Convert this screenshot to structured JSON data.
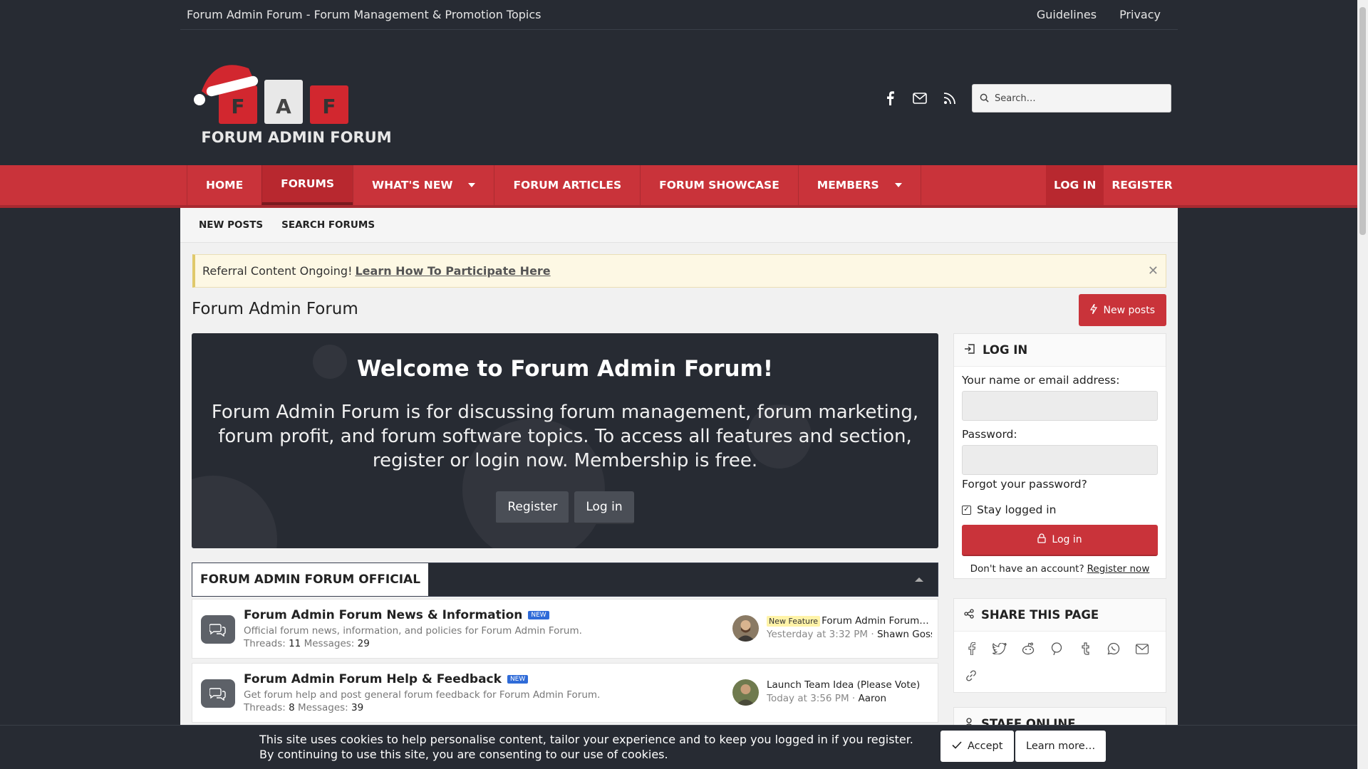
{
  "topbar": {
    "title": "Forum Admin Forum - Forum Management & Promotion Topics",
    "links": [
      "Guidelines",
      "Privacy"
    ]
  },
  "logo": {
    "letters": [
      "F",
      "A",
      "F"
    ],
    "text": "FORUM ADMIN FORUM"
  },
  "search": {
    "placeholder": "Search…"
  },
  "nav": {
    "items": [
      "HOME",
      "FORUMS",
      "WHAT'S NEW",
      "FORUM ARTICLES",
      "FORUM SHOWCASE",
      "MEMBERS"
    ],
    "login": "LOG IN",
    "register": "REGISTER"
  },
  "subnav": [
    "NEW POSTS",
    "SEARCH FORUMS"
  ],
  "notice": {
    "text": "Referral Content Ongoing!",
    "link": "Learn How To Participate Here"
  },
  "page": {
    "title": "Forum Admin Forum",
    "new_posts": "New posts"
  },
  "welcome": {
    "heading": "Welcome to Forum Admin Forum!",
    "body": "Forum Admin Forum is for discussing forum management, forum marketing, forum profit, and forum software topics. To access all features and section, register or login now. Membership is free.",
    "register": "Register",
    "login": "Log in"
  },
  "category": {
    "title": "FORUM ADMIN FORUM OFFICIAL"
  },
  "forums": [
    {
      "title": "Forum Admin Forum News & Information",
      "badge": "NEW",
      "desc": "Official forum news, information, and policies for Forum Admin Forum.",
      "threads_label": "Threads:",
      "threads": "11",
      "messages_label": "Messages:",
      "messages": "29",
      "last_prefix": "New Feature",
      "last_title": "Forum Admin Forum F…",
      "last_time": "Yesterday at 3:32 PM",
      "last_user": "Shawn Gossman"
    },
    {
      "title": "Forum Admin Forum Help & Feedback",
      "badge": "NEW",
      "desc": "Get forum help and post general forum feedback for Forum Admin Forum.",
      "threads_label": "Threads:",
      "threads": "8",
      "messages_label": "Messages:",
      "messages": "39",
      "last_prefix": "",
      "last_title": "Launch Team Idea (Please Vote)",
      "last_time": "Today at 3:56 PM",
      "last_user": "Aaron"
    }
  ],
  "login_block": {
    "title": "LOG IN",
    "name_label": "Your name or email address:",
    "password_label": "Password:",
    "forgot": "Forgot your password?",
    "stay": "Stay logged in",
    "button": "Log in",
    "no_account": "Don't have an account?",
    "register_now": "Register now"
  },
  "share_block": {
    "title": "SHARE THIS PAGE",
    "icons": [
      "facebook-icon",
      "twitter-icon",
      "reddit-icon",
      "pinterest-icon",
      "tumblr-icon",
      "whatsapp-icon",
      "email-icon",
      "link-icon"
    ]
  },
  "staff_block": {
    "title": "STAFF ONLINE"
  },
  "cookie": {
    "line1": "This site uses cookies to help personalise content, tailor your experience and to keep you logged in if you register.",
    "line2": "By continuing to use this site, you are consenting to our use of cookies.",
    "accept": "Accept",
    "learn_more": "Learn more…"
  },
  "colors": {
    "brand_red": "#c9333a",
    "dark_bg": "#272b33",
    "new_badge": "#2f6bd8"
  }
}
